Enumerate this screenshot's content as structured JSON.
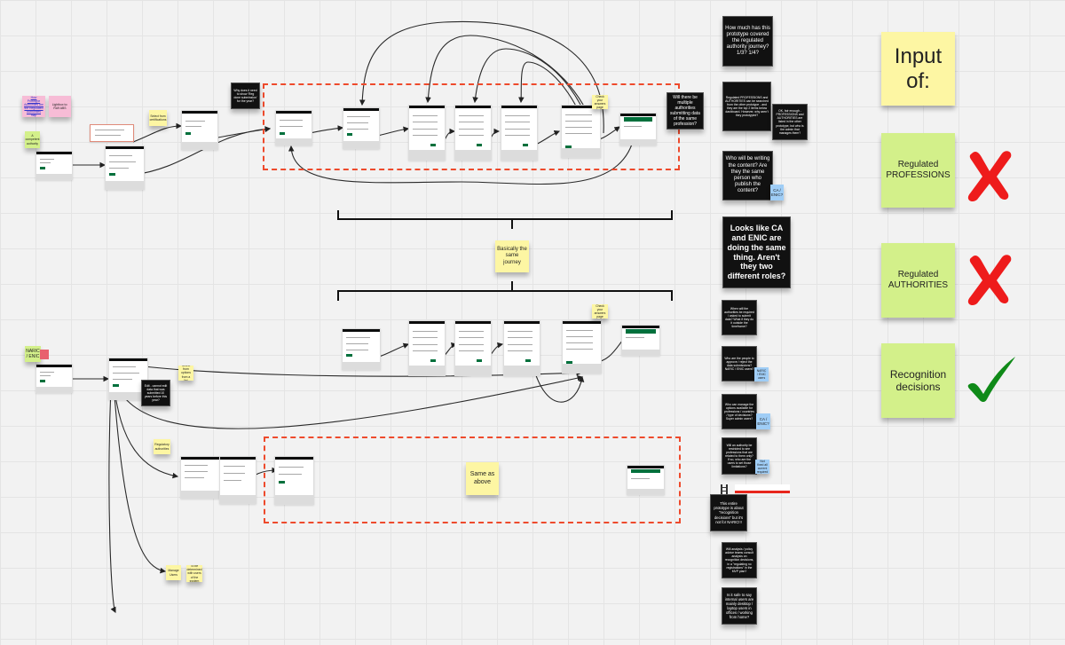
{
  "board": {
    "title_sticky": "Input of:",
    "inputs": [
      {
        "label": "Regulated PROFESSIONS",
        "status": "cross",
        "status_color": "#ee1b1b"
      },
      {
        "label": "Regulated AUTHORITIES",
        "status": "cross",
        "status_color": "#ee1b1b"
      },
      {
        "label": "Recognition decisions",
        "status": "check",
        "status_color": "#0f8a18"
      }
    ]
  },
  "colors": {
    "dashed_frame": "#ee4a2c",
    "sticky_yellow": "#fdf6a3",
    "sticky_green": "#d3f08a",
    "sticky_pink": "#f7bcd6",
    "sticky_blue": "#9fcdf6",
    "sticky_black": "#111111"
  },
  "left_notes": {
    "pink_link": "How Prototype Authorities are the Regulated Authorities map",
    "pink_lightbox": "Lightbox to: RA9 ABS",
    "green_competent": "A competent authority",
    "yellow_select": "Select from certifications",
    "black_question": "Why does it need to show 'Reg done submission' for the year?",
    "nairc": "NARIC / ENIC",
    "yellow_from_options": "Select from options from a list",
    "black_edit": "Edit - cannot edit data that was submitted 10 years before this year?",
    "yellow_regulatory": "Regulatory authorities",
    "yellow_bottom_a": "Manage Users",
    "yellow_bottom_b": "To be determined with users of the system"
  },
  "flow_notes": {
    "check_answers_top": "Check your answers page",
    "check_answers_mid": "Check your answers page",
    "basically_same": "Basically the same journey",
    "same_as_above": "Same as above",
    "multiple_authorities": "Will there be multiple authorities submitting data of the same profession?"
  },
  "questions": [
    {
      "id": "coverage",
      "text": "How much has this prototype covered the regulated authority journey? 1/3? 1/4?"
    },
    {
      "id": "searched",
      "text": "Regulated PROFESSIONS and AUTHORITIES can be searched from the other prototype - and they are the top 2 items below dashboard. However, why aren't they prototyped?"
    },
    {
      "id": "ok_fair",
      "text": "OK, fair enough - PROFESSIONS and AUTHORITIES are listed in the other prototype, but who is the admin that manages them?"
    },
    {
      "id": "writing",
      "text": "Who will be writing the content? Are they the same person who publish the content?"
    },
    {
      "id": "ca_enic_same",
      "text": "Looks like CA and ENIC are doing the same thing. Aren't they two different roles?"
    },
    {
      "id": "when_submit",
      "text": "When will the authorities be required / asked to submit data? What if they do it outside the timeframe?"
    },
    {
      "id": "approve",
      "text": "Who are the people to approve / reject the data submissions? NARIC / ENIC users?"
    },
    {
      "id": "manage_options",
      "text": "Who can manage the options available for professions / countries / type of decisions? Super admin users?"
    },
    {
      "id": "restricted",
      "text": "Will an authority be restricted to see professions that are related to them only? If so, who are the users to set those limitations?"
    },
    {
      "id": "naric_scope",
      "text": "This entire prototype is about \"recognition decisions\" but it's not for NARIC!!!"
    },
    {
      "id": "analysis",
      "text": "Will analysis / policy advice teams consult analysis on recognition decisions, in a \"regulating no registrations\" in the MVP plan?"
    },
    {
      "id": "desktop",
      "text": "Is it safe to say internal users are mainly desktop / laptop users in offices / working from home?"
    }
  ],
  "side_tags": {
    "ca_enic_1": "CA / ENIC?",
    "ca_enic_2": "CA / ENIC?",
    "naric_tag": "NARIC / ENIC users",
    "restricted_tag": "Not fixed all current required"
  }
}
